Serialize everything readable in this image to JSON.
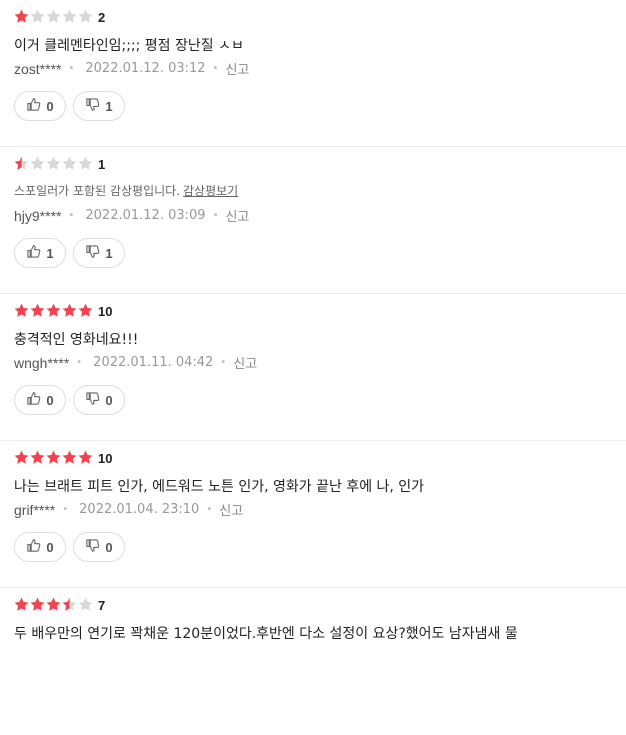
{
  "colors": {
    "star_on": "#f0454f",
    "star_off": "#d8d8d8"
  },
  "reviews": [
    {
      "rating": 1,
      "score_label": "2",
      "text": "이거 클레멘타인임;;;; 평점 장난질 ㅅㅂ",
      "spoiler": false,
      "spoiler_notice": "",
      "spoiler_link": "",
      "user": "zost****",
      "date": "2022.01.12. 03:12",
      "report": "신고",
      "likes": "0",
      "dislikes": "1"
    },
    {
      "rating": 0.5,
      "score_label": "1",
      "text": "",
      "spoiler": true,
      "spoiler_notice": "스포일러가 포함된 감상평입니다.",
      "spoiler_link": "감상평보기",
      "user": "hjy9****",
      "date": "2022.01.12. 03:09",
      "report": "신고",
      "likes": "1",
      "dislikes": "1"
    },
    {
      "rating": 5,
      "score_label": "10",
      "text": "충격적인 영화네요!!!",
      "spoiler": false,
      "spoiler_notice": "",
      "spoiler_link": "",
      "user": "wngh****",
      "date": "2022.01.11. 04:42",
      "report": "신고",
      "likes": "0",
      "dislikes": "0"
    },
    {
      "rating": 5,
      "score_label": "10",
      "text": "나는 브래트 피트 인가, 에드워드 노튼 인가, 영화가 끝난 후에 나, 인가",
      "spoiler": false,
      "spoiler_notice": "",
      "spoiler_link": "",
      "user": "grif****",
      "date": "2022.01.04. 23:10",
      "report": "신고",
      "likes": "0",
      "dislikes": "0"
    },
    {
      "rating": 3.5,
      "score_label": "7",
      "text": "두 배우만의 연기로 꽉채운 120분이었다.후반엔 다소 설정이 요상?했어도 남자냄새 물",
      "spoiler": false,
      "spoiler_notice": "",
      "spoiler_link": "",
      "user": "",
      "date": "",
      "report": "",
      "likes": "",
      "dislikes": ""
    }
  ]
}
